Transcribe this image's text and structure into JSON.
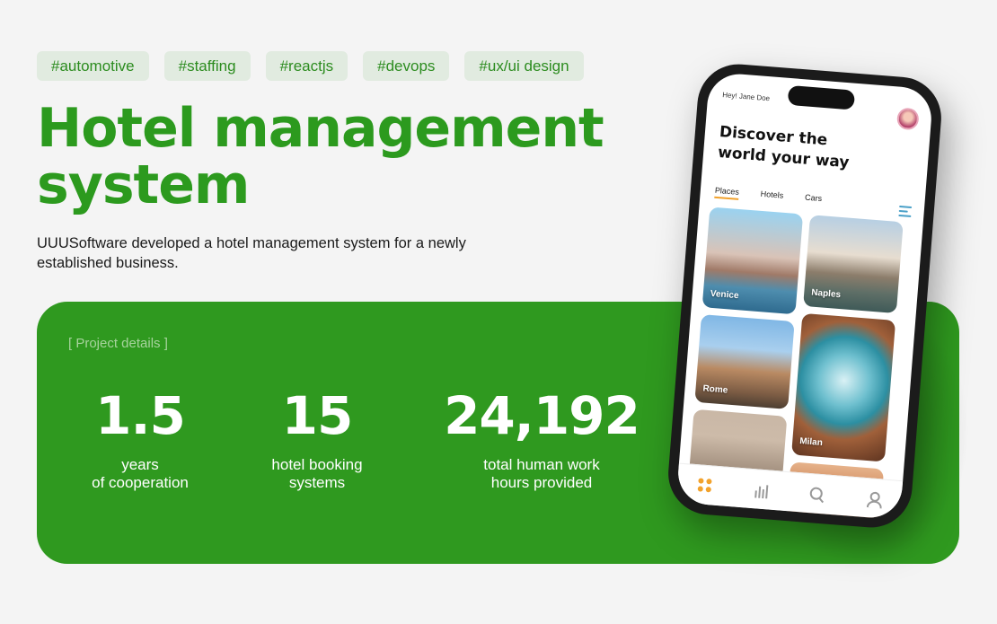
{
  "tags": [
    "#automotive",
    "#staffing",
    "#reactjs",
    "#devops",
    "#ux/ui design"
  ],
  "title": "Hotel management system",
  "description": "UUUSoftware developed a hotel management system for a newly established business.",
  "project": {
    "label": "[ Project details ]",
    "stats": [
      {
        "value": "1.5",
        "label_line1": "years",
        "label_line2": "of cooperation"
      },
      {
        "value": "15",
        "label_line1": "hotel booking",
        "label_line2": "systems"
      },
      {
        "value": "24,192",
        "label_line1": "total human work",
        "label_line2": "hours provided"
      }
    ]
  },
  "phone": {
    "greeting": "Hey! Jane Doe",
    "headline": "Discover the world your way",
    "tabs": [
      "Places",
      "Hotels",
      "Cars"
    ],
    "places": [
      "Venice",
      "Naples",
      "Rome",
      "Milan"
    ],
    "icons": [
      "grid-icon",
      "stats-icon",
      "search-icon",
      "user-icon",
      "filter-icon"
    ]
  },
  "colors": {
    "brand_green": "#2f991f",
    "title_green": "#2c9a1e",
    "tag_bg": "#e1ebe0",
    "accent_orange": "#f2a22c"
  }
}
